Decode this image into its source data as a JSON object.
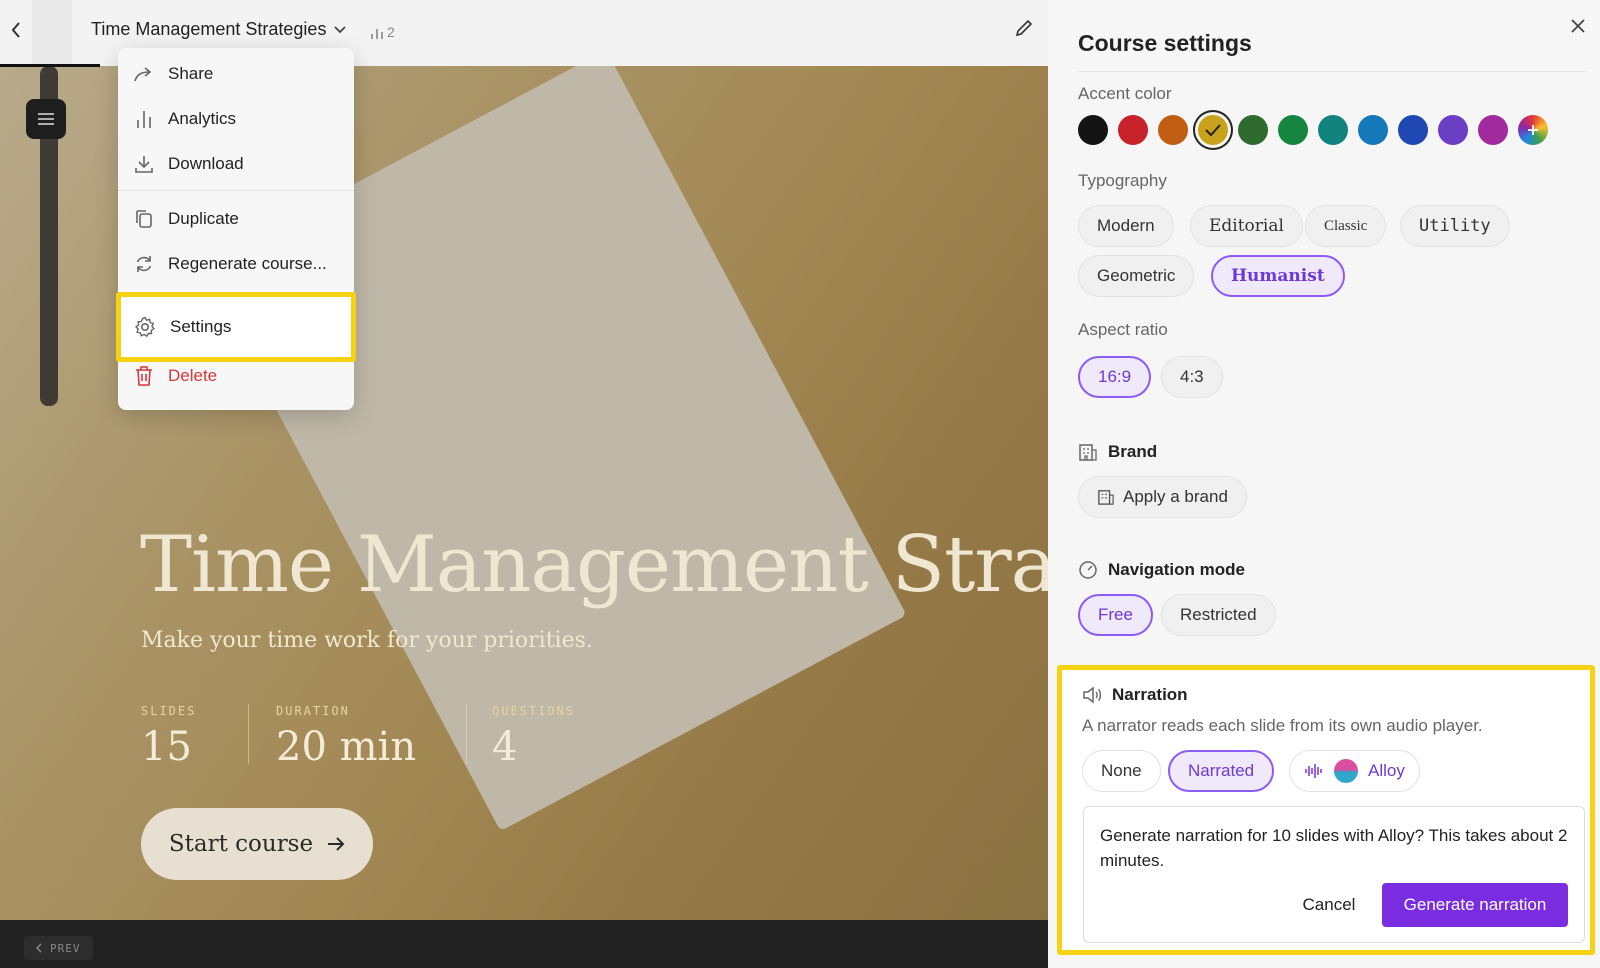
{
  "header": {
    "course_title": "Time Management Strategies",
    "analytics_count": "2"
  },
  "menu": {
    "share": "Share",
    "analytics": "Analytics",
    "download": "Download",
    "duplicate": "Duplicate",
    "regenerate": "Regenerate course...",
    "settings": "Settings",
    "delete": "Delete"
  },
  "hero": {
    "title": "Time Management Strategies",
    "subtitle": "Make your time work for your priorities.",
    "stats": [
      {
        "label": "SLIDES",
        "value": "15"
      },
      {
        "label": "DURATION",
        "value": "20 min"
      },
      {
        "label": "QUESTIONS",
        "value": "4"
      }
    ],
    "start_label": "Start course",
    "prev_label": "PREV"
  },
  "settings": {
    "title": "Course settings",
    "accent_label": "Accent color",
    "accent_colors": [
      "#141414",
      "#c8232b",
      "#c25e13",
      "#c9a21b",
      "#2f6a2f",
      "#16853f",
      "#11847f",
      "#1578b8",
      "#1f48b3",
      "#6a3fc4",
      "#a12a9e"
    ],
    "accent_selected": "#c9a21b",
    "typography_label": "Typography",
    "typography_options": [
      "Modern",
      "Editorial",
      "Classic",
      "Utility",
      "Geometric",
      "Humanist"
    ],
    "typography_selected": "Humanist",
    "aspect_label": "Aspect ratio",
    "aspect_options": [
      "16:9",
      "4:3"
    ],
    "aspect_selected": "16:9",
    "brand_label": "Brand",
    "apply_brand_label": "Apply a brand",
    "nav_label": "Navigation mode",
    "nav_options": [
      "Free",
      "Restricted"
    ],
    "nav_selected": "Free",
    "narration_label": "Narration",
    "narration_desc": "A narrator reads each slide from its own audio player.",
    "narration_options": [
      "None",
      "Narrated"
    ],
    "narration_selected": "Narrated",
    "voice_name": "Alloy",
    "confirm_text": "Generate narration for 10 slides with Alloy? This takes about 2 minutes.",
    "cancel_label": "Cancel",
    "generate_label": "Generate narration"
  }
}
